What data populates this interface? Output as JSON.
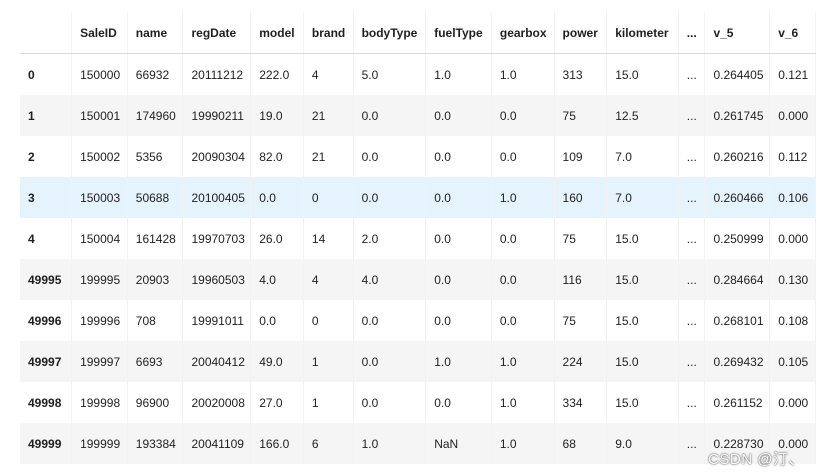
{
  "table": {
    "columns": [
      "",
      "SaleID",
      "name",
      "regDate",
      "model",
      "brand",
      "bodyType",
      "fuelType",
      "gearbox",
      "power",
      "kilometer",
      "...",
      "v_5",
      "v_6"
    ],
    "rows": [
      {
        "index": "0",
        "cells": [
          "150000",
          "66932",
          "20111212",
          "222.0",
          "4",
          "5.0",
          "1.0",
          "1.0",
          "313",
          "15.0",
          "...",
          "0.264405",
          "0.121"
        ]
      },
      {
        "index": "1",
        "cells": [
          "150001",
          "174960",
          "19990211",
          "19.0",
          "21",
          "0.0",
          "0.0",
          "0.0",
          "75",
          "12.5",
          "...",
          "0.261745",
          "0.000"
        ]
      },
      {
        "index": "2",
        "cells": [
          "150002",
          "5356",
          "20090304",
          "82.0",
          "21",
          "0.0",
          "0.0",
          "0.0",
          "109",
          "7.0",
          "...",
          "0.260216",
          "0.112"
        ]
      },
      {
        "index": "3",
        "cells": [
          "150003",
          "50688",
          "20100405",
          "0.0",
          "0",
          "0.0",
          "0.0",
          "1.0",
          "160",
          "7.0",
          "...",
          "0.260466",
          "0.106"
        ]
      },
      {
        "index": "4",
        "cells": [
          "150004",
          "161428",
          "19970703",
          "26.0",
          "14",
          "2.0",
          "0.0",
          "0.0",
          "75",
          "15.0",
          "...",
          "0.250999",
          "0.000"
        ]
      },
      {
        "index": "49995",
        "cells": [
          "199995",
          "20903",
          "19960503",
          "4.0",
          "4",
          "4.0",
          "0.0",
          "0.0",
          "116",
          "15.0",
          "...",
          "0.284664",
          "0.130"
        ]
      },
      {
        "index": "49996",
        "cells": [
          "199996",
          "708",
          "19991011",
          "0.0",
          "0",
          "0.0",
          "0.0",
          "0.0",
          "75",
          "15.0",
          "...",
          "0.268101",
          "0.108"
        ]
      },
      {
        "index": "49997",
        "cells": [
          "199997",
          "6693",
          "20040412",
          "49.0",
          "1",
          "0.0",
          "1.0",
          "1.0",
          "224",
          "15.0",
          "...",
          "0.269432",
          "0.105"
        ]
      },
      {
        "index": "49998",
        "cells": [
          "199998",
          "96900",
          "20020008",
          "27.0",
          "1",
          "0.0",
          "0.0",
          "1.0",
          "334",
          "15.0",
          "...",
          "0.261152",
          "0.000"
        ]
      },
      {
        "index": "49999",
        "cells": [
          "199999",
          "193384",
          "20041109",
          "166.0",
          "6",
          "1.0",
          "NaN",
          "1.0",
          "68",
          "9.0",
          "...",
          "0.228730",
          "0.000"
        ]
      }
    ],
    "hover_row_index": "3"
  },
  "watermark": "CSDN @汀、",
  "colors": {
    "row_alt": "#f5f5f5",
    "row_hover": "#e5f3fc",
    "text": "#1f1f1f"
  }
}
